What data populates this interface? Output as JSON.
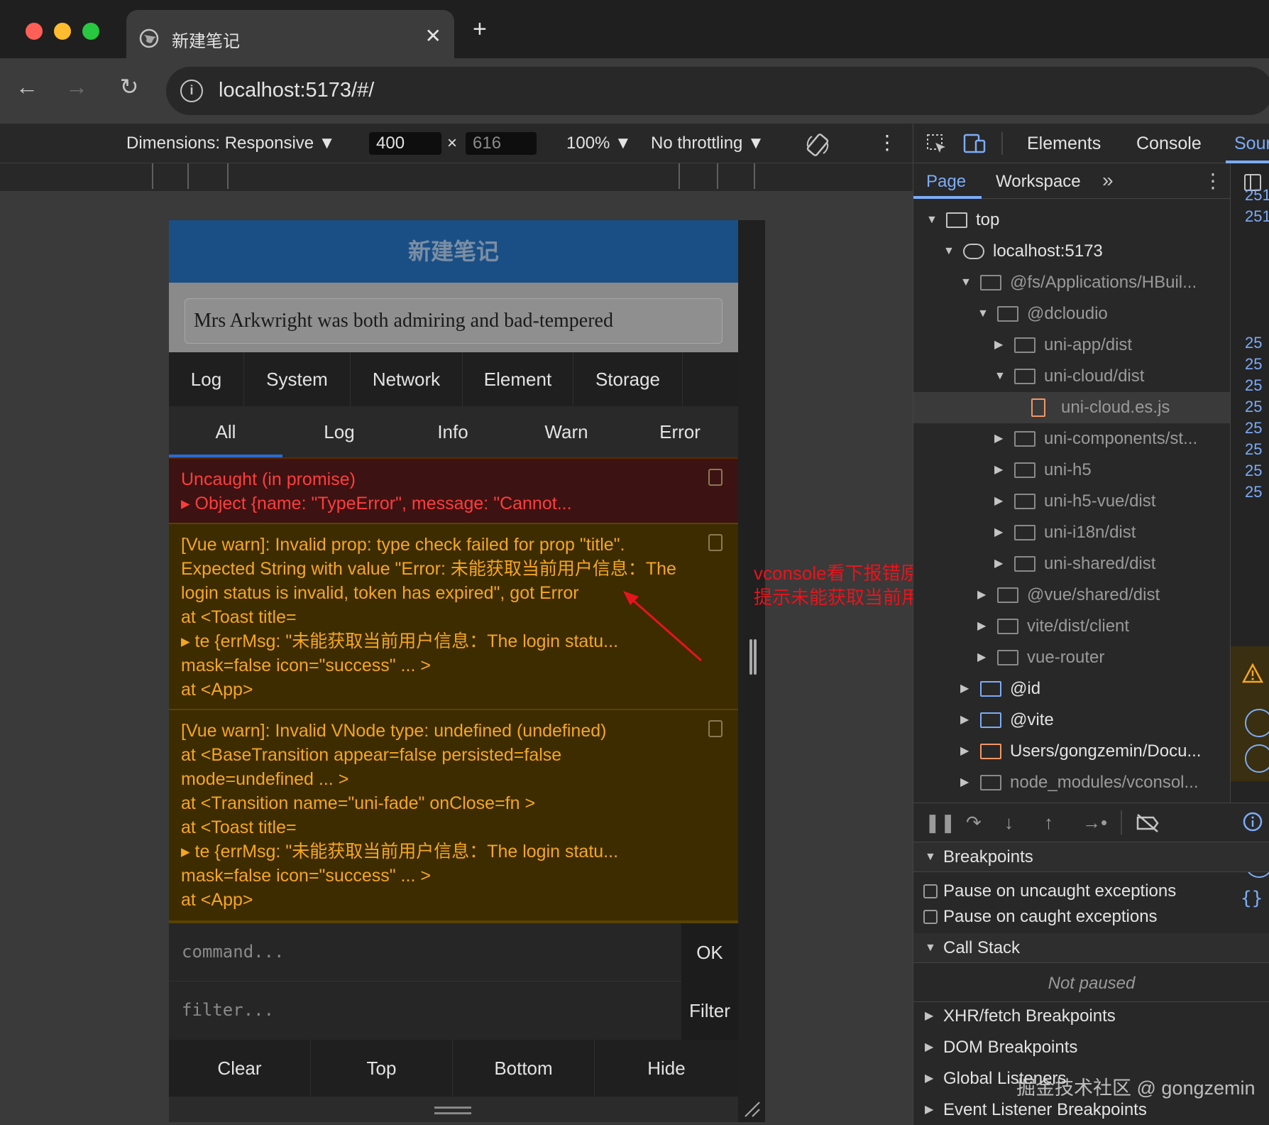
{
  "browser": {
    "tab_title": "新建笔记",
    "close_glyph": "✕",
    "new_tab_glyph": "+",
    "url": "localhost:5173/#/",
    "info_glyph": "i",
    "back_glyph": "←",
    "forward_glyph": "→",
    "reload_glyph": "↻"
  },
  "device_toolbar": {
    "dimensions": "Dimensions: Responsive ▼",
    "width": "400",
    "times": "×",
    "height": "616",
    "zoom": "100% ▼",
    "throttling": "No throttling ▼",
    "more_glyph": "⋮"
  },
  "app": {
    "header_title": "新建笔记",
    "note_text": "Mrs Arkwright was both admiring and bad-tempered"
  },
  "vconsole": {
    "tabs": [
      "Log",
      "System",
      "Network",
      "Element",
      "Storage"
    ],
    "subtabs": [
      "All",
      "Log",
      "Info",
      "Warn",
      "Error"
    ],
    "entries": [
      {
        "type": "error",
        "lines": [
          "Uncaught (in promise)",
          "▸ Object {name: \"TypeError\", message: \"Cannot..."
        ]
      },
      {
        "type": "warn",
        "lines": [
          "[Vue warn]: Invalid prop: type check failed for prop \"title\".",
          "Expected String with value \"Error: 未能获取当前用户信息：The",
          "login status is invalid, token has expired\", got Error",
          " at <Toast title=",
          "▸ te {errMsg: \"未能获取当前用户信息：The login statu...",
          "mask=false icon=\"success\"  ... >",
          " at <App>"
        ]
      },
      {
        "type": "warn",
        "lines": [
          "[Vue warn]: Invalid VNode type: undefined (undefined)",
          " at <BaseTransition appear=false persisted=false",
          "mode=undefined  ... >",
          " at <Transition name=\"uni-fade\" onClose=fn >",
          " at <Toast title=",
          "▸ te {errMsg: \"未能获取当前用户信息：The login statu...",
          "mask=false icon=\"success\"  ... >",
          " at <App>"
        ]
      }
    ],
    "command_placeholder": "command...",
    "ok_label": "OK",
    "filter_placeholder": "filter...",
    "filter_label": "Filter",
    "bottom_buttons": [
      "Clear",
      "Top",
      "Bottom",
      "Hide"
    ]
  },
  "annotation": {
    "line1": "vconsole看下报错原因",
    "line2": "提示未能获取当前用户信息",
    "color": "#e8141c"
  },
  "devtools": {
    "panel_tabs": [
      "Elements",
      "Console",
      "Sour"
    ],
    "nav_tabs": [
      "Page",
      "Workspace",
      "»"
    ],
    "tree": [
      {
        "label": "top",
        "depth": 0,
        "expanded": true,
        "kind": "frame"
      },
      {
        "label": "localhost:5173",
        "depth": 1,
        "expanded": true,
        "kind": "cloud"
      },
      {
        "label": "@fs/Applications/HBuil...",
        "depth": 2,
        "expanded": true,
        "kind": "folder-dim"
      },
      {
        "label": "@dcloudio",
        "depth": 3,
        "expanded": true,
        "kind": "folder-dim"
      },
      {
        "label": "uni-app/dist",
        "depth": 4,
        "expanded": false,
        "kind": "folder-dim"
      },
      {
        "label": "uni-cloud/dist",
        "depth": 4,
        "expanded": true,
        "kind": "folder-dim"
      },
      {
        "label": "uni-cloud.es.js",
        "depth": 5,
        "expanded": null,
        "kind": "file"
      },
      {
        "label": "uni-components/st...",
        "depth": 4,
        "expanded": false,
        "kind": "folder-dim"
      },
      {
        "label": "uni-h5",
        "depth": 4,
        "expanded": false,
        "kind": "folder-dim"
      },
      {
        "label": "uni-h5-vue/dist",
        "depth": 4,
        "expanded": false,
        "kind": "folder-dim"
      },
      {
        "label": "uni-i18n/dist",
        "depth": 4,
        "expanded": false,
        "kind": "folder-dim"
      },
      {
        "label": "uni-shared/dist",
        "depth": 4,
        "expanded": false,
        "kind": "folder-dim"
      },
      {
        "label": "@vue/shared/dist",
        "depth": 3,
        "expanded": false,
        "kind": "folder-dim"
      },
      {
        "label": "vite/dist/client",
        "depth": 3,
        "expanded": false,
        "kind": "folder-dim"
      },
      {
        "label": "vue-router",
        "depth": 3,
        "expanded": false,
        "kind": "folder-dim"
      },
      {
        "label": "@id",
        "depth": 2,
        "expanded": false,
        "kind": "folder-blue"
      },
      {
        "label": "@vite",
        "depth": 2,
        "expanded": false,
        "kind": "folder-blue"
      },
      {
        "label": "Users/gongzemin/Docu...",
        "depth": 2,
        "expanded": false,
        "kind": "folder-orange"
      },
      {
        "label": "node_modules/vconsol...",
        "depth": 2,
        "expanded": false,
        "kind": "folder-dim"
      }
    ],
    "gutter_numbers": [
      "251",
      "251",
      "25",
      "25",
      "25",
      "25",
      "25",
      "25",
      "25",
      "25"
    ],
    "sections": {
      "breakpoints": "Breakpoints",
      "pause_uncaught": "Pause on uncaught exceptions",
      "pause_caught": "Pause on caught exceptions",
      "call_stack": "Call Stack",
      "not_paused": "Not paused",
      "xhr": "XHR/fetch Breakpoints",
      "dom": "DOM Breakpoints",
      "global": "Global Listeners",
      "event": "Event Listener Breakpoints"
    }
  },
  "watermark": "掘金技术社区 @ gongzemin"
}
